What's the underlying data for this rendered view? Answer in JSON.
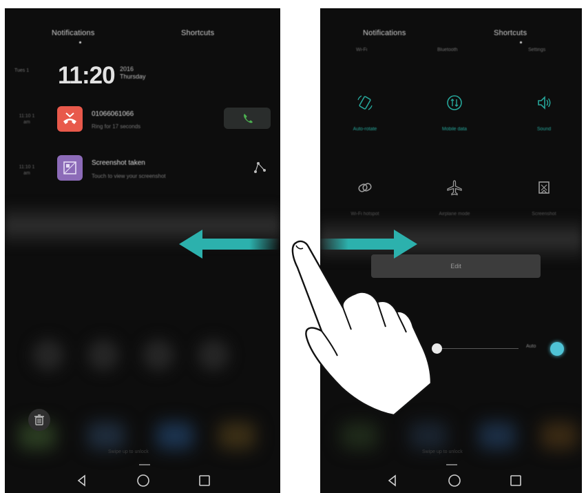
{
  "left_screen": {
    "tabs": {
      "notifications": "Notifications",
      "shortcuts": "Shortcuts"
    },
    "date_label": "Tues 1",
    "clock": {
      "time": "11:20",
      "line1": "2016",
      "line2": "Thursday"
    },
    "notifications": [
      {
        "time": "11:10 1\nam",
        "title": "01066061066",
        "subtitle": "Ring for 17 seconds",
        "icon": "missed-call-icon",
        "color": "#e8594b"
      },
      {
        "time": "11:10 1\nam",
        "title": "Screenshot taken",
        "subtitle": "Touch to view your screenshot",
        "icon": "screenshot-icon",
        "color": "#8c6bb8"
      }
    ],
    "bottom_hint": "Swipe up to unlock"
  },
  "right_screen": {
    "tabs": {
      "notifications": "Notifications",
      "shortcuts": "Shortcuts"
    },
    "sub_tabs": [
      "Wi-Fi",
      "Bluetooth",
      "Settings"
    ],
    "tiles": [
      {
        "label": "Auto-rotate",
        "icon": "rotate-icon",
        "active": true
      },
      {
        "label": "Mobile data",
        "icon": "mobile-data-icon",
        "active": true
      },
      {
        "label": "Sound",
        "icon": "sound-icon",
        "active": true
      },
      {
        "label": "Wi-Fi hotspot",
        "icon": "hotspot-icon",
        "active": false
      },
      {
        "label": "Airplane mode",
        "icon": "airplane-icon",
        "active": false
      },
      {
        "label": "Screenshot",
        "icon": "screenshot-icon",
        "active": false
      }
    ],
    "edit_label": "Edit",
    "brightness_auto_label": "Auto",
    "bottom_hint": "Swipe up to unlock"
  },
  "colors": {
    "accent": "#26a69a",
    "arrow": "#2cb1ad",
    "background": "#0d0d0d"
  },
  "overlay_icons": [
    "double-arrow-icon",
    "hand-pointer-icon"
  ]
}
